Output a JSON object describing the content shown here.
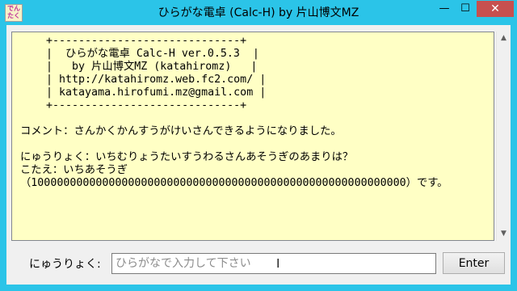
{
  "window": {
    "title": "ひらがな電卓 (Calc-H) by 片山博文MZ",
    "icon_text": "でんたく",
    "minimize_label": "—",
    "maximize_label": "☐",
    "close_label": "✕"
  },
  "output": {
    "text": "    +-----------------------------+\n    |  ひらがな電卓 Calc-H ver.0.5.3  |\n    |   by 片山博文MZ (katahiromz)   |\n    | http://katahiromz.web.fc2.com/ |\n    | katayama.hirofumi.mz@gmail.com |\n    +-----------------------------+\n\nコメント：さんかくかんすうがけいさんできるようになりました。\n\nにゅうりょく：いちむりょうたいすうわるさんあそうぎのあまりは？\nこたえ：いちあそうぎ\n（1000000000000000000000000000000000000000000000000000000000）です。"
  },
  "input": {
    "label": "にゅうりょく:",
    "placeholder": "ひらがなで入力して下さい",
    "value": ""
  },
  "enter_button": {
    "label": "Enter"
  },
  "icons": {
    "app": "app-icon",
    "scroll_up": "scroll-up-icon",
    "scroll_down": "scroll-down-icon",
    "cursor": "text-cursor-icon"
  }
}
